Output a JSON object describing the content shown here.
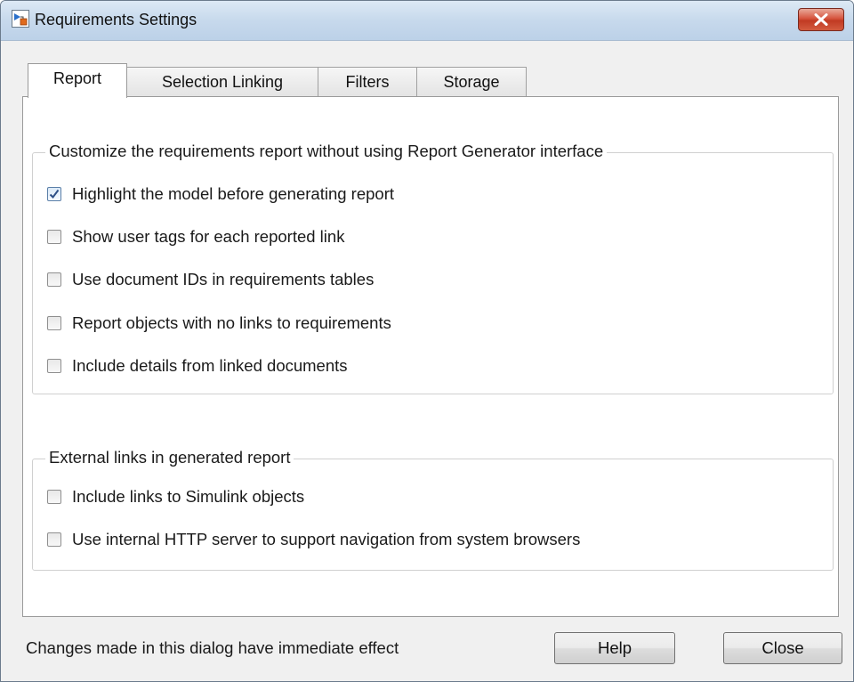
{
  "window": {
    "title": "Requirements Settings",
    "icon": "simulink-app-icon",
    "close_icon": "close-x-icon"
  },
  "tabs": [
    {
      "label": "Report",
      "active": true
    },
    {
      "label": "Selection Linking",
      "active": false
    },
    {
      "label": "Filters",
      "active": false
    },
    {
      "label": "Storage",
      "active": false
    }
  ],
  "report": {
    "group1": {
      "legend": "Customize the requirements report without using Report Generator interface",
      "options": [
        {
          "label": "Highlight the model before generating report",
          "checked": true
        },
        {
          "label": "Show user tags for each reported link",
          "checked": false
        },
        {
          "label": "Use document IDs in requirements tables",
          "checked": false
        },
        {
          "label": "Report objects with no links to requirements",
          "checked": false
        },
        {
          "label": "Include details from linked documents",
          "checked": false
        }
      ]
    },
    "group2": {
      "legend": "External links in generated report",
      "options": [
        {
          "label": "Include links to Simulink objects",
          "checked": false
        },
        {
          "label": "Use internal HTTP server to support navigation from system browsers",
          "checked": false
        }
      ]
    }
  },
  "footer": {
    "message": "Changes made in this dialog have immediate effect",
    "help_label": "Help",
    "close_label": "Close"
  },
  "colors": {
    "close_button": "#c13a23",
    "checkbox_checked_border": "#5b7fa8",
    "checkmark": "#2d4f86"
  }
}
